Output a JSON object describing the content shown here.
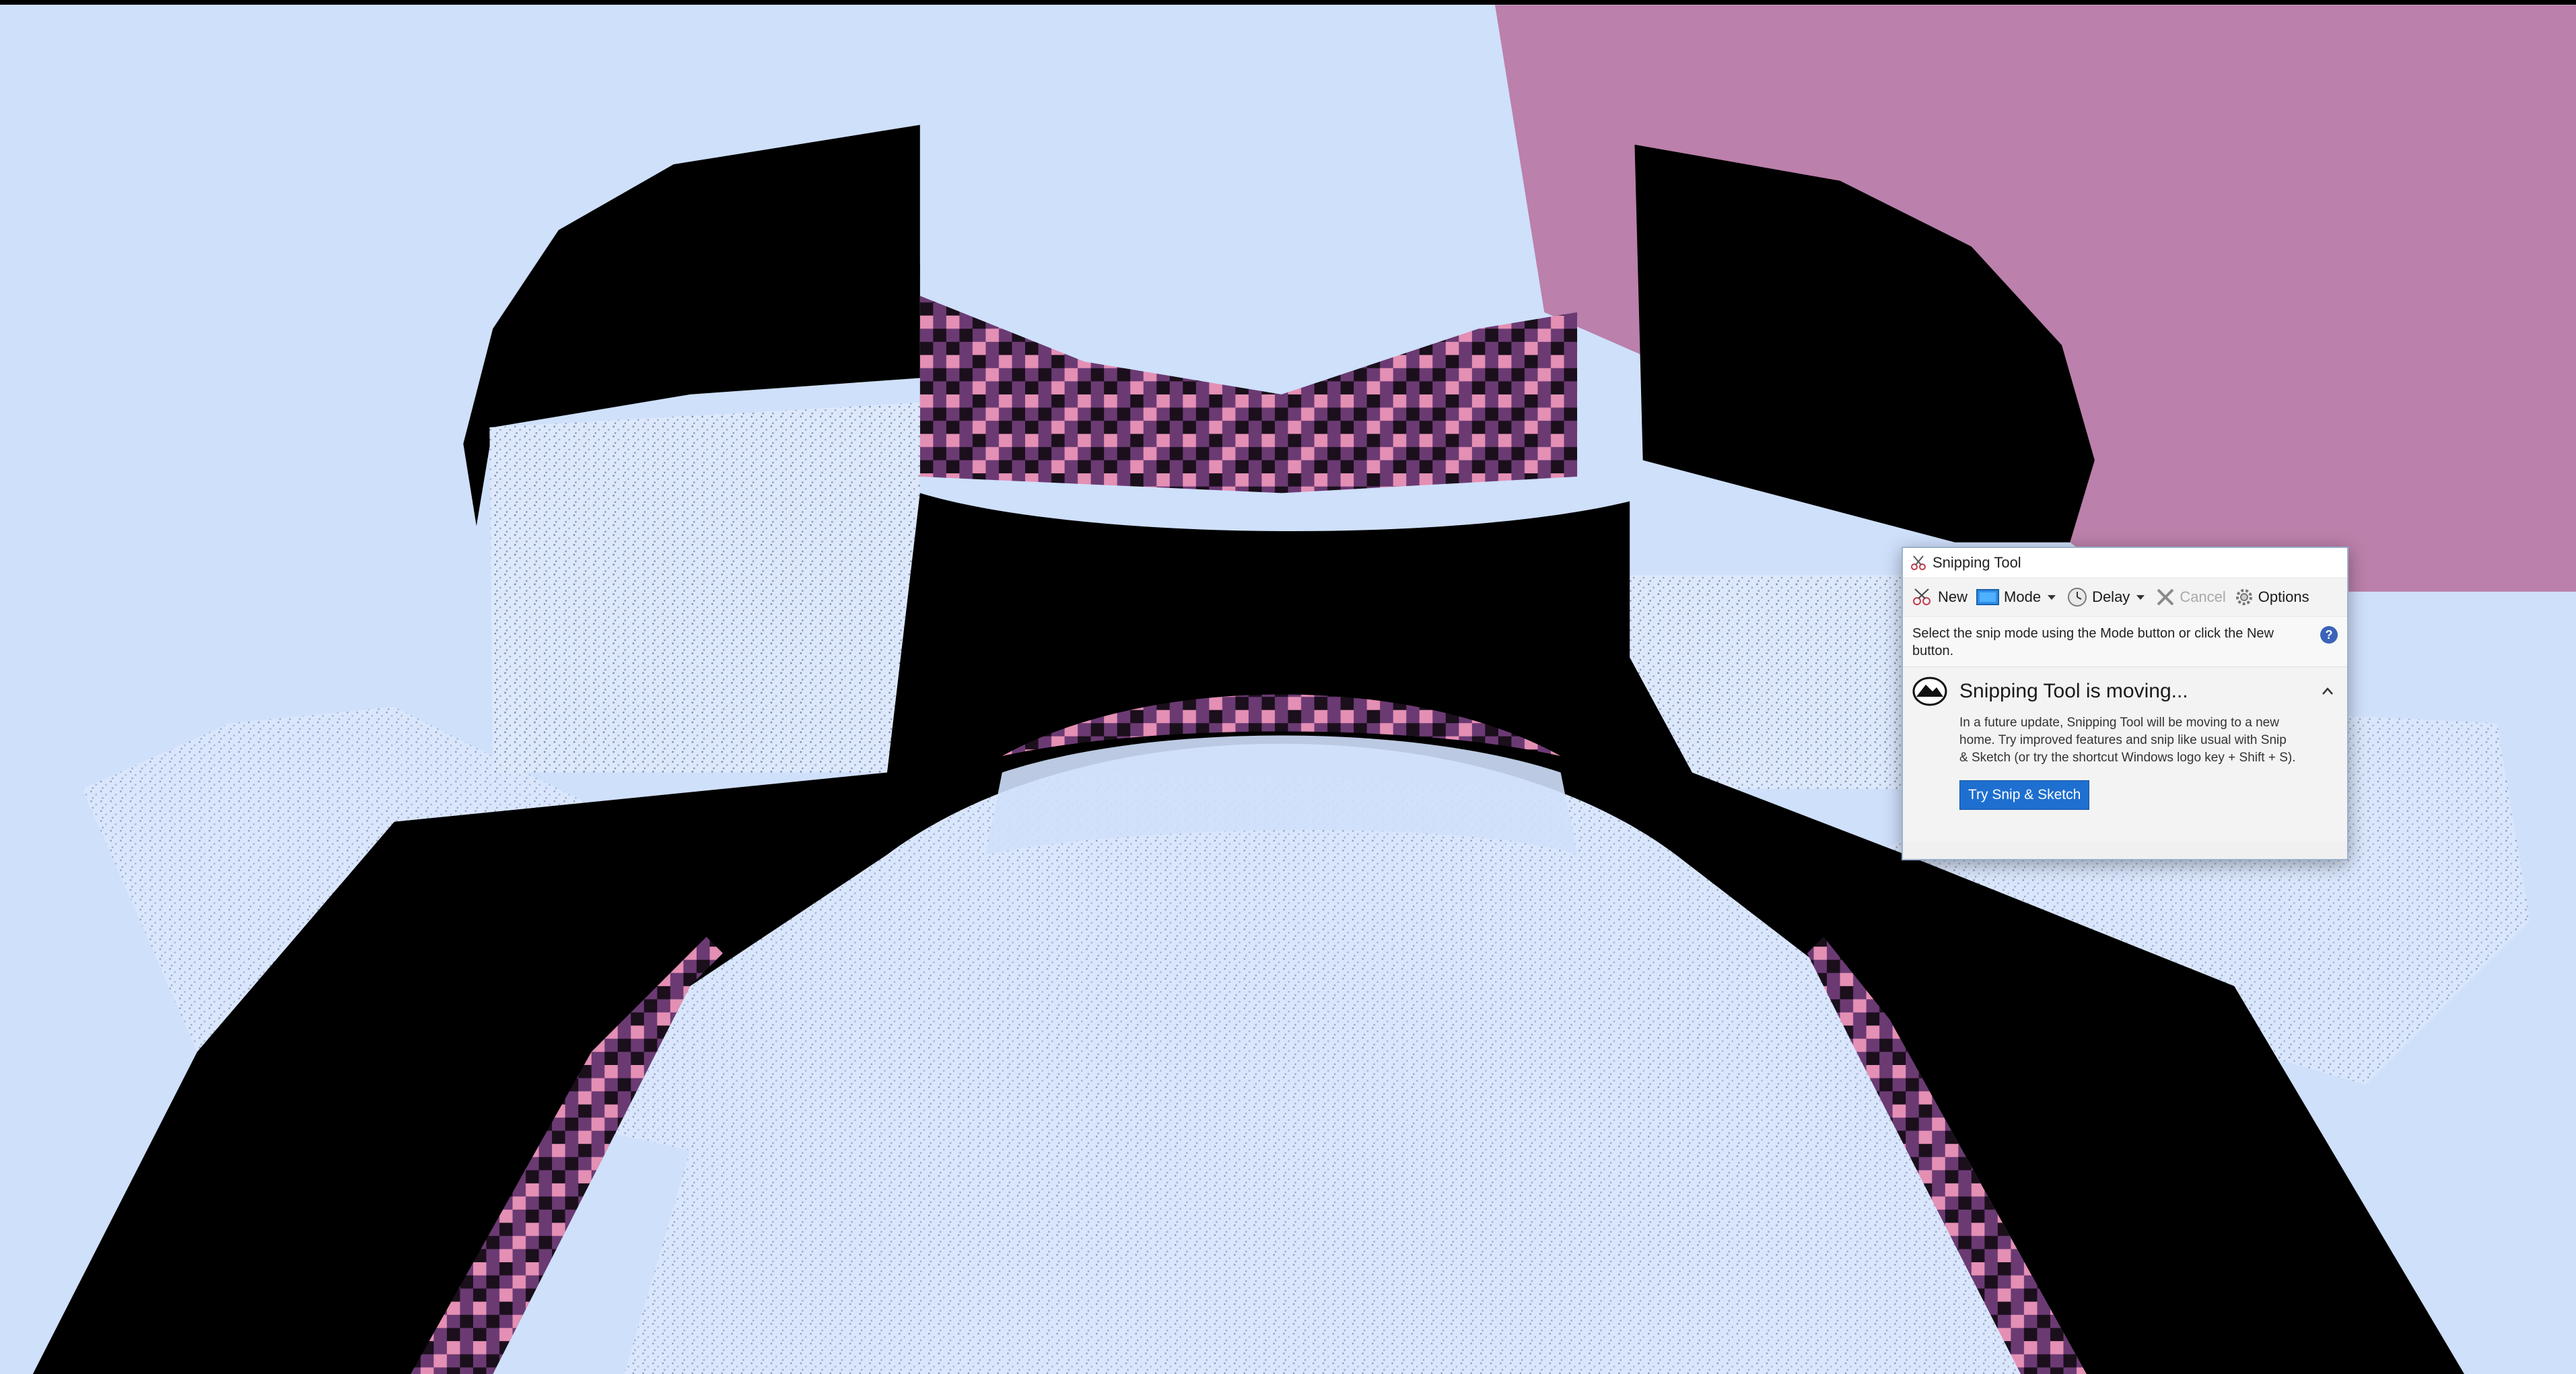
{
  "snipping_tool": {
    "title": "Snipping Tool",
    "toolbar": {
      "new_label": "New",
      "mode_label": "Mode",
      "delay_label": "Delay",
      "cancel_label": "Cancel",
      "options_label": "Options"
    },
    "instruction": "Select the snip mode using the Mode button or click the New button.",
    "notice": {
      "title": "Snipping Tool is moving...",
      "body": "In a future update, Snipping Tool will be moving to a new home. Try improved features and snip like usual with Snip & Sketch (or try the shortcut Windows logo key + Shift + S).",
      "button_label": "Try Snip & Sketch"
    }
  },
  "colors": {
    "sky": "#cfe0fb",
    "pink_wall": "#bb80ab",
    "dark_block": "#000000",
    "pattern_pink": "#e48fb4",
    "pattern_purple": "#6b3a73",
    "accent_button": "#1e6fd0"
  }
}
